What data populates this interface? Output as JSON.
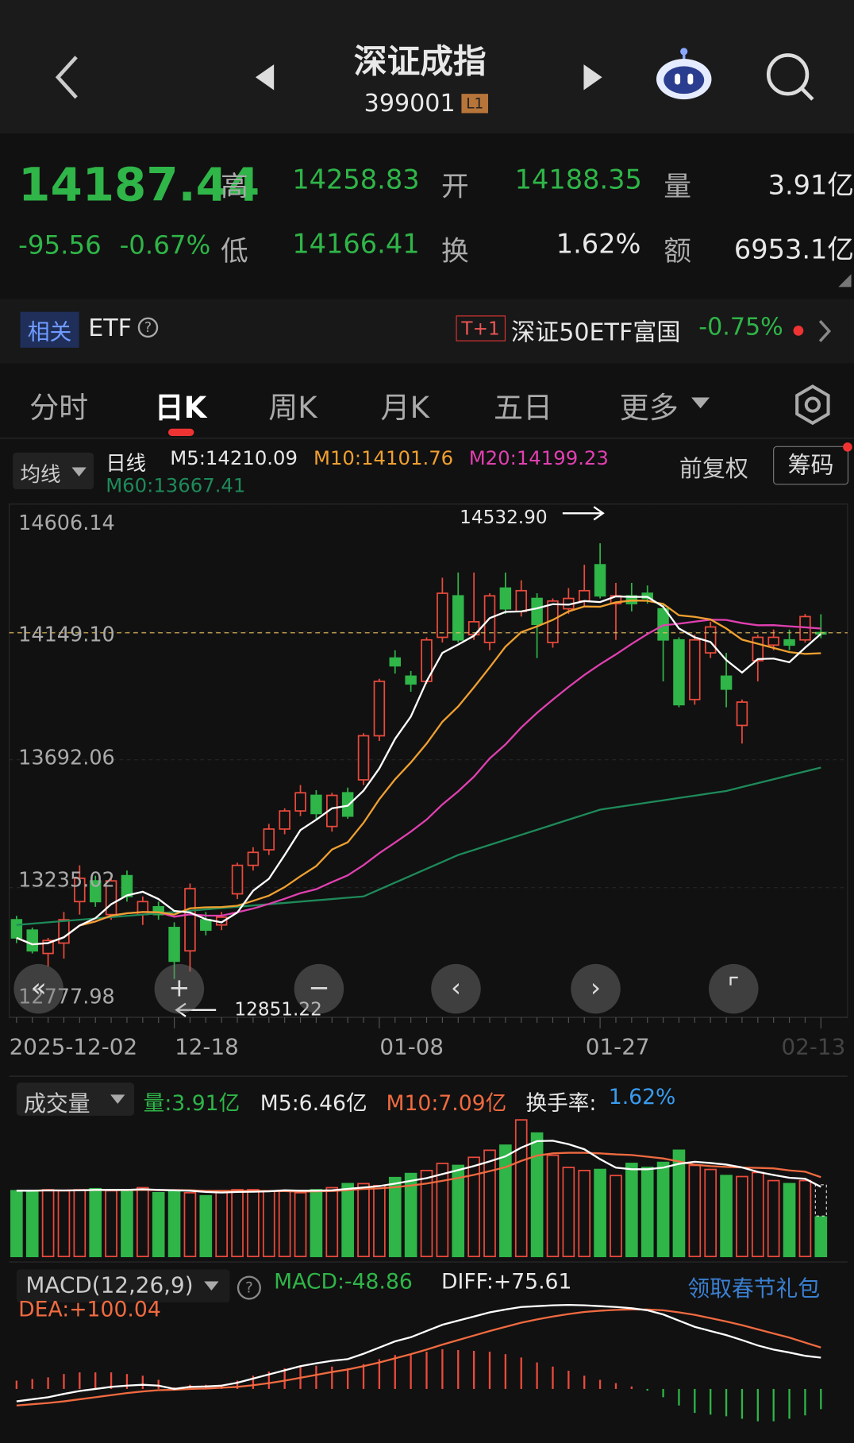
{
  "header": {
    "title": "深证成指",
    "code": "399001",
    "level_badge": "L1"
  },
  "quote": {
    "price": "14187.44",
    "change": "-95.56",
    "change_pct": "-0.67%",
    "high_label": "高",
    "high": "14258.83",
    "open_label": "开",
    "open": "14188.35",
    "volume_label": "量",
    "volume": "3.91亿",
    "low_label": "低",
    "low": "14166.41",
    "turnover_label": "换",
    "turnover": "1.62%",
    "amount_label": "额",
    "amount": "6953.1亿"
  },
  "etf": {
    "related_badge": "相关",
    "etf_label": "ETF",
    "tplus": "T+1",
    "fund_name": "深证50ETF富国",
    "fund_change": "-0.75%"
  },
  "tabs": [
    {
      "label": "分时"
    },
    {
      "label": "日K"
    },
    {
      "label": "周K"
    },
    {
      "label": "月K"
    },
    {
      "label": "五日"
    },
    {
      "label": "更多"
    }
  ],
  "legend": {
    "ma_select": "均线",
    "period": "日线",
    "m5": "M5:14210.09",
    "m10": "M10:14101.76",
    "m20": "M20:14199.23",
    "m60": "M60:13667.41",
    "adjust": "前复权",
    "chips": "筹码"
  },
  "colors": {
    "up": "#ea4a3c",
    "down": "#2fb548",
    "m5": "#ffffff",
    "m10": "#f0a030",
    "m20": "#e040b0",
    "m60": "#1e8a5a"
  },
  "chart_data": {
    "type": "candlestick",
    "y_ticks": [
      "14606.14",
      "14149.10",
      "13692.06",
      "13235.02",
      "12777.98"
    ],
    "y_range": [
      12777.98,
      14606.14
    ],
    "max_label": "14532.90",
    "min_label": "12851.22",
    "x_labels": [
      "2025-12-02",
      "12-18",
      "01-08",
      "01-27",
      "02-13"
    ],
    "ohlc": [
      [
        13080,
        13095,
        12990,
        13010
      ],
      [
        13040,
        13050,
        12950,
        12960
      ],
      [
        12950,
        13010,
        12900,
        13000
      ],
      [
        12990,
        13110,
        12930,
        13080
      ],
      [
        13150,
        13290,
        13100,
        13240
      ],
      [
        13230,
        13250,
        13130,
        13150
      ],
      [
        13100,
        13250,
        13080,
        13230
      ],
      [
        13250,
        13270,
        13150,
        13170
      ],
      [
        13100,
        13170,
        13060,
        13150
      ],
      [
        13130,
        13150,
        13080,
        13100
      ],
      [
        13050,
        13070,
        12851.22,
        12920
      ],
      [
        12960,
        13220,
        12880,
        13200
      ],
      [
        13080,
        13110,
        13020,
        13040
      ],
      [
        13060,
        13110,
        13040,
        13090
      ],
      [
        13180,
        13300,
        13160,
        13290
      ],
      [
        13290,
        13360,
        13270,
        13340
      ],
      [
        13350,
        13450,
        13330,
        13430
      ],
      [
        13430,
        13510,
        13410,
        13500
      ],
      [
        13500,
        13600,
        13480,
        13570
      ],
      [
        13560,
        13580,
        13470,
        13490
      ],
      [
        13440,
        13570,
        13420,
        13560
      ],
      [
        13570,
        13590,
        13470,
        13480
      ],
      [
        13620,
        13800,
        13600,
        13790
      ],
      [
        13790,
        14010,
        13770,
        14000
      ],
      [
        14090,
        14120,
        14030,
        14060
      ],
      [
        14020,
        14040,
        13960,
        13990
      ],
      [
        14000,
        14170,
        13990,
        14160
      ],
      [
        14170,
        14400,
        14150,
        14340
      ],
      [
        14330,
        14420,
        14150,
        14160
      ],
      [
        14180,
        14420,
        14160,
        14230
      ],
      [
        14150,
        14340,
        14120,
        14330
      ],
      [
        14360,
        14420,
        14260,
        14280
      ],
      [
        14270,
        14390,
        14250,
        14350
      ],
      [
        14320,
        14340,
        14090,
        14220
      ],
      [
        14150,
        14320,
        14130,
        14310
      ],
      [
        14280,
        14360,
        14260,
        14320
      ],
      [
        14310,
        14450,
        14290,
        14350
      ],
      [
        14450,
        14532.9,
        14320,
        14330
      ],
      [
        14300,
        14380,
        14160,
        14330
      ],
      [
        14330,
        14380,
        14270,
        14300
      ],
      [
        14340,
        14370,
        14300,
        14320
      ],
      [
        14280,
        14300,
        14000,
        14160
      ],
      [
        14160,
        14170,
        13900,
        13910
      ],
      [
        13930,
        14180,
        13910,
        14160
      ],
      [
        14110,
        14230,
        14090,
        14210
      ],
      [
        14020,
        14110,
        13900,
        13970
      ],
      [
        13830,
        13930,
        13760,
        13920
      ],
      [
        14080,
        14180,
        14000,
        14170
      ],
      [
        14140,
        14200,
        14120,
        14170
      ],
      [
        14160,
        14200,
        14120,
        14140
      ],
      [
        14160,
        14260,
        14150,
        14250
      ],
      [
        14188.35,
        14258.83,
        14166.41,
        14187.44
      ]
    ],
    "ma60_anchors": [
      [
        0,
        13060
      ],
      [
        22,
        13170
      ],
      [
        28,
        13330
      ],
      [
        37,
        13505
      ],
      [
        45,
        13577
      ],
      [
        51,
        13667.41
      ]
    ],
    "volume": [
      6.5,
      6.5,
      6.6,
      6.5,
      6.6,
      6.7,
      6.5,
      6.6,
      6.8,
      6.3,
      6.5,
      6.3,
      6.0,
      6.5,
      6.6,
      6.6,
      6.5,
      6.5,
      6.3,
      6.6,
      6.8,
      7.2,
      7.2,
      7.0,
      7.8,
      8.2,
      8.5,
      9.2,
      9.0,
      9.8,
      10.5,
      11.0,
      13.5,
      12.2,
      10.0,
      8.8,
      8.5,
      8.6,
      8.0,
      9.2,
      8.8,
      9.3,
      10.5,
      9.0,
      8.6,
      8.0,
      7.9,
      8.3,
      7.5,
      7.2,
      7.5,
      3.91
    ],
    "diff": [
      -30,
      -25,
      -20,
      -12,
      -5,
      0,
      5,
      8,
      10,
      8,
      0,
      5,
      6,
      8,
      15,
      25,
      35,
      45,
      55,
      62,
      68,
      72,
      85,
      100,
      115,
      125,
      140,
      155,
      165,
      175,
      185,
      192,
      198,
      200,
      202,
      203,
      202,
      200,
      198,
      195,
      190,
      180,
      165,
      150,
      140,
      130,
      118,
      105,
      95,
      88,
      80,
      75.61
    ],
    "dea": [
      -40,
      -37,
      -34,
      -30,
      -25,
      -20,
      -15,
      -10,
      -6,
      -3,
      -2,
      0,
      1,
      3,
      5,
      9,
      14,
      20,
      27,
      34,
      41,
      47,
      55,
      64,
      74,
      84,
      95,
      107,
      118,
      129,
      140,
      150,
      160,
      168,
      175,
      181,
      186,
      189,
      191,
      192,
      192,
      190,
      185,
      179,
      171,
      163,
      154,
      144,
      134,
      124,
      112,
      100.04
    ]
  },
  "volume_panel": {
    "select": "成交量",
    "vol": "量:3.91亿",
    "m5": "M5:6.46亿",
    "m10": "M10:7.09亿",
    "turnover_label": "换手率:",
    "turnover": "1.62%"
  },
  "macd_panel": {
    "select": "MACD(12,26,9)",
    "macd": "MACD:-48.86",
    "diff": "DIFF:+75.61",
    "dea": "DEA:+100.04",
    "promo": "领取春节礼包"
  }
}
